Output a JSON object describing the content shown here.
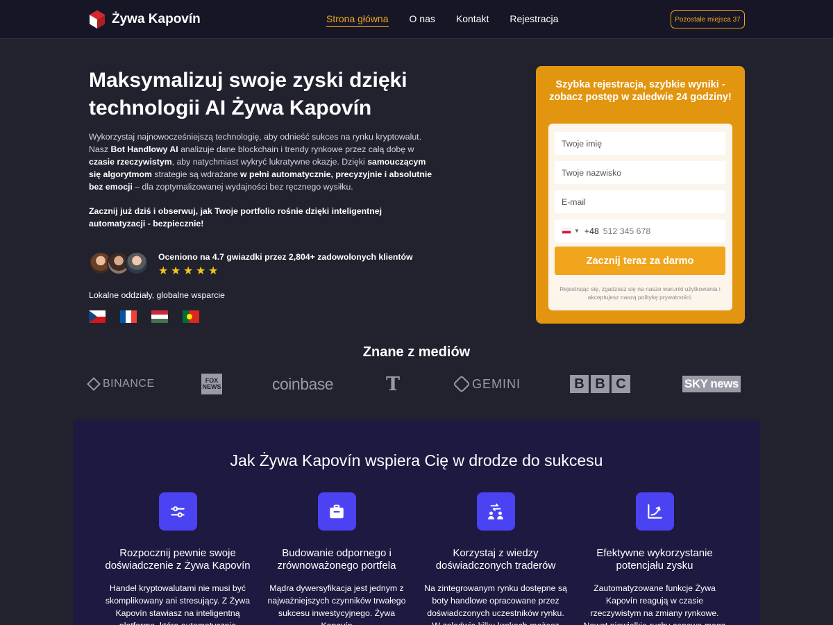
{
  "nav": {
    "brand": "Żywa Kapovín",
    "links": [
      "Strona główna",
      "O nas",
      "Kontakt",
      "Rejestracja"
    ],
    "seats": "Pozostałe miejsca 37"
  },
  "hero": {
    "title": "Maksymalizuj swoje zyski dzięki technologii AI Żywa Kapovín",
    "p1": "Wykorzystaj najnowocześniejszą technologię, aby odnieść sukces na rynku kryptowalut. Nasz ",
    "b1": "Bot Handlowy AI",
    "p2": " analizuje dane blockchain i trendy rynkowe przez całą dobę w ",
    "b2": "czasie rzeczywistym",
    "p3": ", aby natychmiast wykryć lukratywne okazje. Dzięki ",
    "b3": "samouczącym się algorytmom",
    "p4": " strategie są wdrażane ",
    "b4": "w pełni automatycznie, precyzyjnie i absolutnie bez emocji",
    "p5": " – dla zoptymalizowanej wydajności bez ręcznego wysiłku.",
    "cta": "Zacznij już dziś i obserwuj, jak Twoje portfolio rośnie dzięki inteligentnej automatyzacji - bezpiecznie!",
    "rating_text": "Oceniono na 4.7 gwiazdki przez 2,804+ zadowolonych klientów",
    "stars": 5,
    "local": "Lokalne oddziały, globalne wsparcie",
    "flags": [
      "cz",
      "fr",
      "hu",
      "pt"
    ]
  },
  "form": {
    "title": "Szybka rejestracja, szybkie wyniki - zobacz postęp w zaledwie 24 godziny!",
    "first_name": "Twoje imię",
    "last_name": "Twoje nazwisko",
    "email": "E-mail",
    "phone_code": "+48",
    "phone_placeholder": "512 345 678",
    "submit": "Zacznij teraz za darmo",
    "terms": "Rejestrując się, zgadzasz się na nasze warunki użytkowania i akceptujesz naszą politykę prywatności."
  },
  "media": {
    "title": "Znane z mediów",
    "logos": {
      "binance": "BINANCE",
      "fox_top": "FOX",
      "fox_bottom": "NEWS",
      "coinbase": "coinbase",
      "nyt": "T",
      "gemini": "GEMINI",
      "bbc": [
        "B",
        "B",
        "C"
      ],
      "sky": "SKY news"
    }
  },
  "features": {
    "title": "Jak Żywa Kapovín wspiera Cię w drodze do sukcesu",
    "items": [
      {
        "title": "Rozpocznij pewnie swoje doświadczenie z Żywa Kapovín",
        "text": "Handel kryptowalutami nie musi być skomplikowany ani stresujący. Z Żywa Kapovín stawiasz na inteligentną platformę, która automatycznie wdraża",
        "icon": "sliders-icon"
      },
      {
        "title": "Budowanie odpornego i zrównoważonego portfela",
        "text": "Mądra dywersyfikacja jest jednym z najważniejszych czynników trwałego sukcesu inwestycyjnego. Żywa Kapovín",
        "icon": "briefcase-icon"
      },
      {
        "title": "Korzystaj z wiedzy doświadczonych traderów",
        "text": "Na zintegrowanym rynku dostępne są boty handlowe opracowane przez doświadczonych uczestników rynku. W zaledwie kilku krokach możesz",
        "icon": "users-exchange-icon"
      },
      {
        "title": "Efektywne wykorzystanie potencjału zysku",
        "text": "Zautomatyzowane funkcje Żywa Kapovín reagują w czasie rzeczywistym na zmiany rynkowe. Nawet niewielkie ruchy cenowe mogą być",
        "icon": "growth-chart-icon"
      }
    ]
  },
  "colors": {
    "accent": "#f0a51c",
    "card": "#e2950f",
    "feature_icon": "#4b43f2",
    "panel": "#1d1940",
    "background": "#22222f"
  }
}
